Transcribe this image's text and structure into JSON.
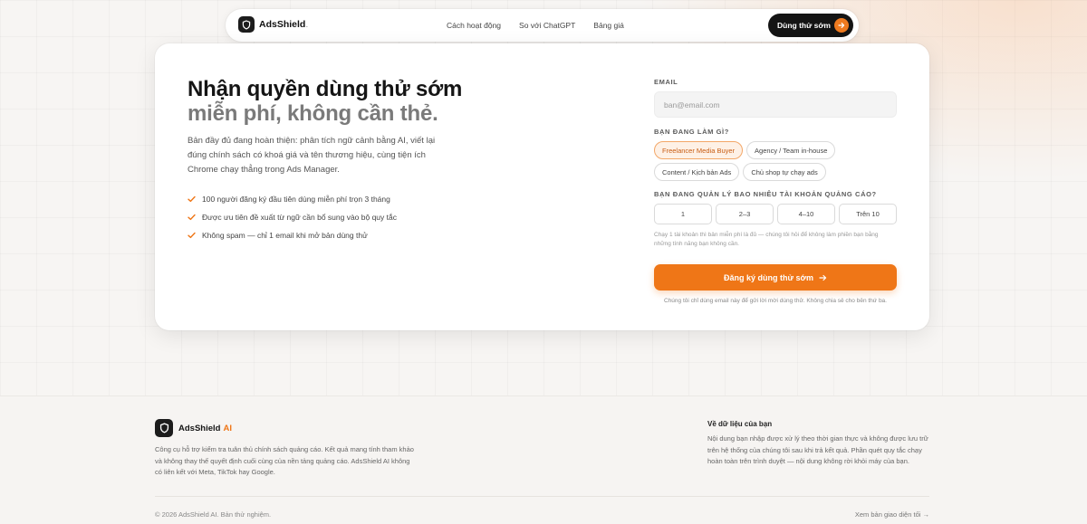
{
  "nav": {
    "brand": "AdsShield",
    "brand_dot": ".",
    "links": [
      "Cách hoạt động",
      "So với ChatGPT",
      "Bảng giá"
    ],
    "cta": "Dùng thử sớm"
  },
  "hero": {
    "title_line1": "Nhận quyền dùng thử sớm",
    "title_line2": "miễn phí, không cần thẻ.",
    "description": "Bản đầy đủ đang hoàn thiện: phân tích ngữ cảnh bằng AI, viết lại đúng chính sách có khoá giá và tên thương hiệu, cùng tiện ích Chrome chạy thẳng trong Ads Manager.",
    "bullets": [
      "100 người đăng ký đầu tiên dùng miễn phí trọn 3 tháng",
      "Được ưu tiên đề xuất từ ngữ cần bổ sung vào bộ quy tắc",
      "Không spam — chỉ 1 email khi mở bản dùng thử"
    ]
  },
  "form": {
    "email_label": "EMAIL",
    "email_placeholder": "ban@email.com",
    "role_label": "BẠN ĐANG LÀM GÌ?",
    "roles": [
      {
        "label": "Freelancer Media Buyer",
        "selected": true
      },
      {
        "label": "Agency / Team in-house",
        "selected": false
      },
      {
        "label": "Content / Kịch bản Ads",
        "selected": false
      },
      {
        "label": "Chủ shop tự chạy ads",
        "selected": false
      }
    ],
    "accounts_label": "BẠN ĐANG QUẢN LÝ BAO NHIÊU TÀI KHOẢN QUẢNG CÁO?",
    "account_options": [
      "1",
      "2–3",
      "4–10",
      "Trên 10"
    ],
    "hint": "Chạy 1 tài khoản thì bản miễn phí là đủ — chúng tôi hỏi để không làm phiền bạn bằng những tính năng bạn không cần.",
    "submit": "Đăng ký dùng thử sớm",
    "privacy": "Chúng tôi chỉ dùng email này để gửi lời mời dùng thử. Không chia sẻ cho bên thứ ba."
  },
  "footer": {
    "brand": "AdsShield",
    "brand_ai": "AI",
    "description": "Công cụ hỗ trợ kiểm tra tuân thủ chính sách quảng cáo. Kết quả mang tính tham khảo và không thay thế quyết định cuối cùng của nền tảng quảng cáo. AdsShield AI không có liên kết với Meta, TikTok hay Google.",
    "data_title": "Về dữ liệu của bạn",
    "data_text": "Nội dung bạn nhập được xử lý theo thời gian thực và không được lưu trữ trên hệ thống của chúng tôi sau khi trả kết quả. Phần quét quy tắc chạy hoàn toàn trên trình duyệt — nội dung không rời khỏi máy của bạn.",
    "copyright": "© 2026 AdsShield AI. Bản thử nghiệm.",
    "link": "Xem bản giao diện tối →"
  },
  "colors": {
    "accent": "#ef7617",
    "dark": "#141414",
    "chip_selected_bg": "#fef1e6"
  },
  "icons": {
    "logo": "shield-icon",
    "cta_arrow": "arrow-right-icon",
    "bullet": "check-icon"
  }
}
